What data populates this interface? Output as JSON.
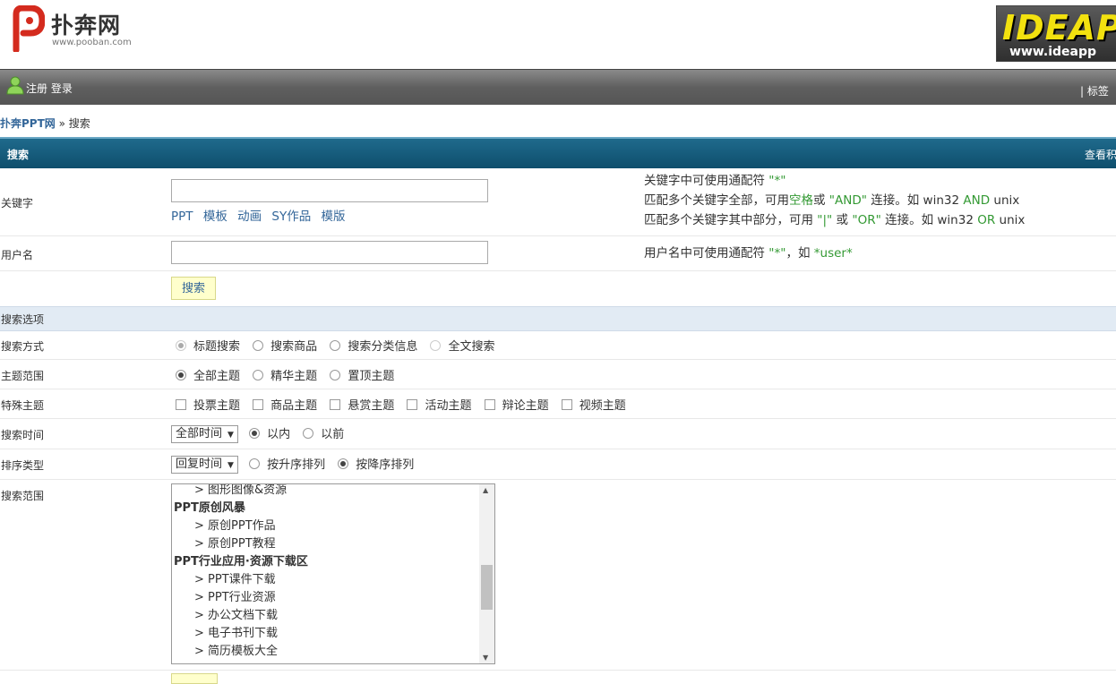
{
  "header": {
    "brand_name": "扑奔网",
    "brand_url": "www.pooban.com",
    "banner_text": "IDEAP",
    "banner_url": "www.ideapp"
  },
  "navbar": {
    "register": "注册",
    "login": "登录",
    "right_link": "| 标签"
  },
  "breadcrumb": {
    "home": "扑奔PPT网",
    "sep": " » ",
    "current": "搜索"
  },
  "titlebar": {
    "title": "搜索",
    "right": "查看积"
  },
  "keyword": {
    "label": "关键字",
    "value": "",
    "hot_links": [
      "PPT",
      "模板",
      "动画",
      "SY作品",
      "模版"
    ],
    "hint1_a": "关键字中可使用通配符 ",
    "hint1_b": "\"*\"",
    "hint2_a": "匹配多个关键字全部，可用",
    "hint2_b": "空格",
    "hint2_c": "或 ",
    "hint2_d": "\"AND\"",
    "hint2_e": " 连接。如 win32 ",
    "hint2_f": "AND",
    "hint2_g": " unix",
    "hint3_a": "匹配多个关键字其中部分，可用 ",
    "hint3_b": "\"|\"",
    "hint3_c": " 或 ",
    "hint3_d": "\"OR\"",
    "hint3_e": " 连接。如 win32 ",
    "hint3_f": "OR",
    "hint3_g": " unix"
  },
  "username": {
    "label": "用户名",
    "value": "",
    "hint_a": "用户名中可使用通配符 ",
    "hint_b": "\"*\"",
    "hint_c": "，如 ",
    "hint_d": "*user*"
  },
  "search_button": "搜索",
  "options_header": "搜索选项",
  "search_mode": {
    "label": "搜索方式",
    "options": [
      "标题搜索",
      "搜索商品",
      "搜索分类信息",
      "全文搜索"
    ],
    "selected": "标题搜索"
  },
  "topic_range": {
    "label": "主题范围",
    "options": [
      "全部主题",
      "精华主题",
      "置顶主题"
    ],
    "selected": "全部主题"
  },
  "special_topics": {
    "label": "特殊主题",
    "options": [
      "投票主题",
      "商品主题",
      "悬赏主题",
      "活动主题",
      "辩论主题",
      "视频主题"
    ]
  },
  "search_time": {
    "label": "搜索时间",
    "select_value": "全部时间",
    "options": [
      "以内",
      "以前"
    ],
    "selected": "以内"
  },
  "sort_type": {
    "label": "排序类型",
    "select_value": "回复时间",
    "options": [
      "按升序排列",
      "按降序排列"
    ],
    "selected": "按降序排列"
  },
  "scope": {
    "label": "搜索范围",
    "items": [
      {
        "text": "> 图形图像&资源",
        "type": "sub"
      },
      {
        "text": "PPT原创风暴",
        "type": "grp"
      },
      {
        "text": "> 原创PPT作品",
        "type": "sub"
      },
      {
        "text": "> 原创PPT教程",
        "type": "sub"
      },
      {
        "text": "PPT行业应用·资源下载区",
        "type": "grp"
      },
      {
        "text": "> PPT课件下载",
        "type": "sub"
      },
      {
        "text": "> PPT行业资源",
        "type": "sub"
      },
      {
        "text": "> 办公文档下载",
        "type": "sub"
      },
      {
        "text": "> 电子书刊下载",
        "type": "sub"
      },
      {
        "text": "> 简历模板大全",
        "type": "sub"
      }
    ]
  },
  "colors": {
    "accent": "#0e4e6c",
    "link": "#336699",
    "hint_green": "#339933",
    "button_bg": "#ffffcc",
    "option_bar": "#e2ebf4"
  }
}
